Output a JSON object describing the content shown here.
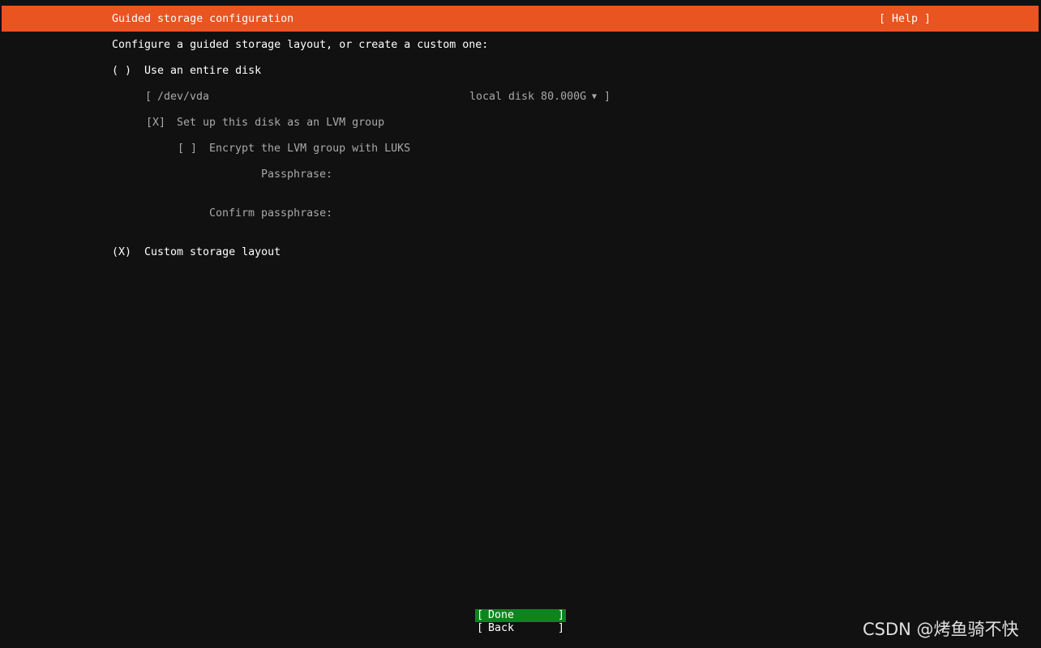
{
  "header": {
    "title": "Guided storage configuration",
    "help_label": "[ Help ]"
  },
  "instructions": "Configure a guided storage layout, or create a custom one:",
  "entire_disk": {
    "radio": "( )",
    "label": "Use an entire disk",
    "disk_select": {
      "open_bracket": "[",
      "device": "/dev/vda",
      "description": "local disk 80.000G",
      "arrow": "▼",
      "close_bracket": "]"
    },
    "lvm": {
      "checkbox": "[X]",
      "label": "Set up this disk as an LVM group"
    },
    "luks": {
      "checkbox": "[ ]",
      "label": "Encrypt the LVM group with LUKS"
    },
    "passphrase_label": "Passphrase:",
    "confirm_passphrase_label": "Confirm passphrase:"
  },
  "custom_layout": {
    "radio": "(X)",
    "label": "Custom storage layout"
  },
  "buttons": {
    "done": {
      "open": "[",
      "label": "Done",
      "close": "]"
    },
    "back": {
      "open": "[",
      "label": "Back",
      "close": "]"
    }
  },
  "watermark": "CSDN @烤鱼骑不快",
  "colors": {
    "title_bar": "#e95420",
    "background": "#111111",
    "focused_button": "#0e8420",
    "disabled_text": "#a9a9a9"
  }
}
